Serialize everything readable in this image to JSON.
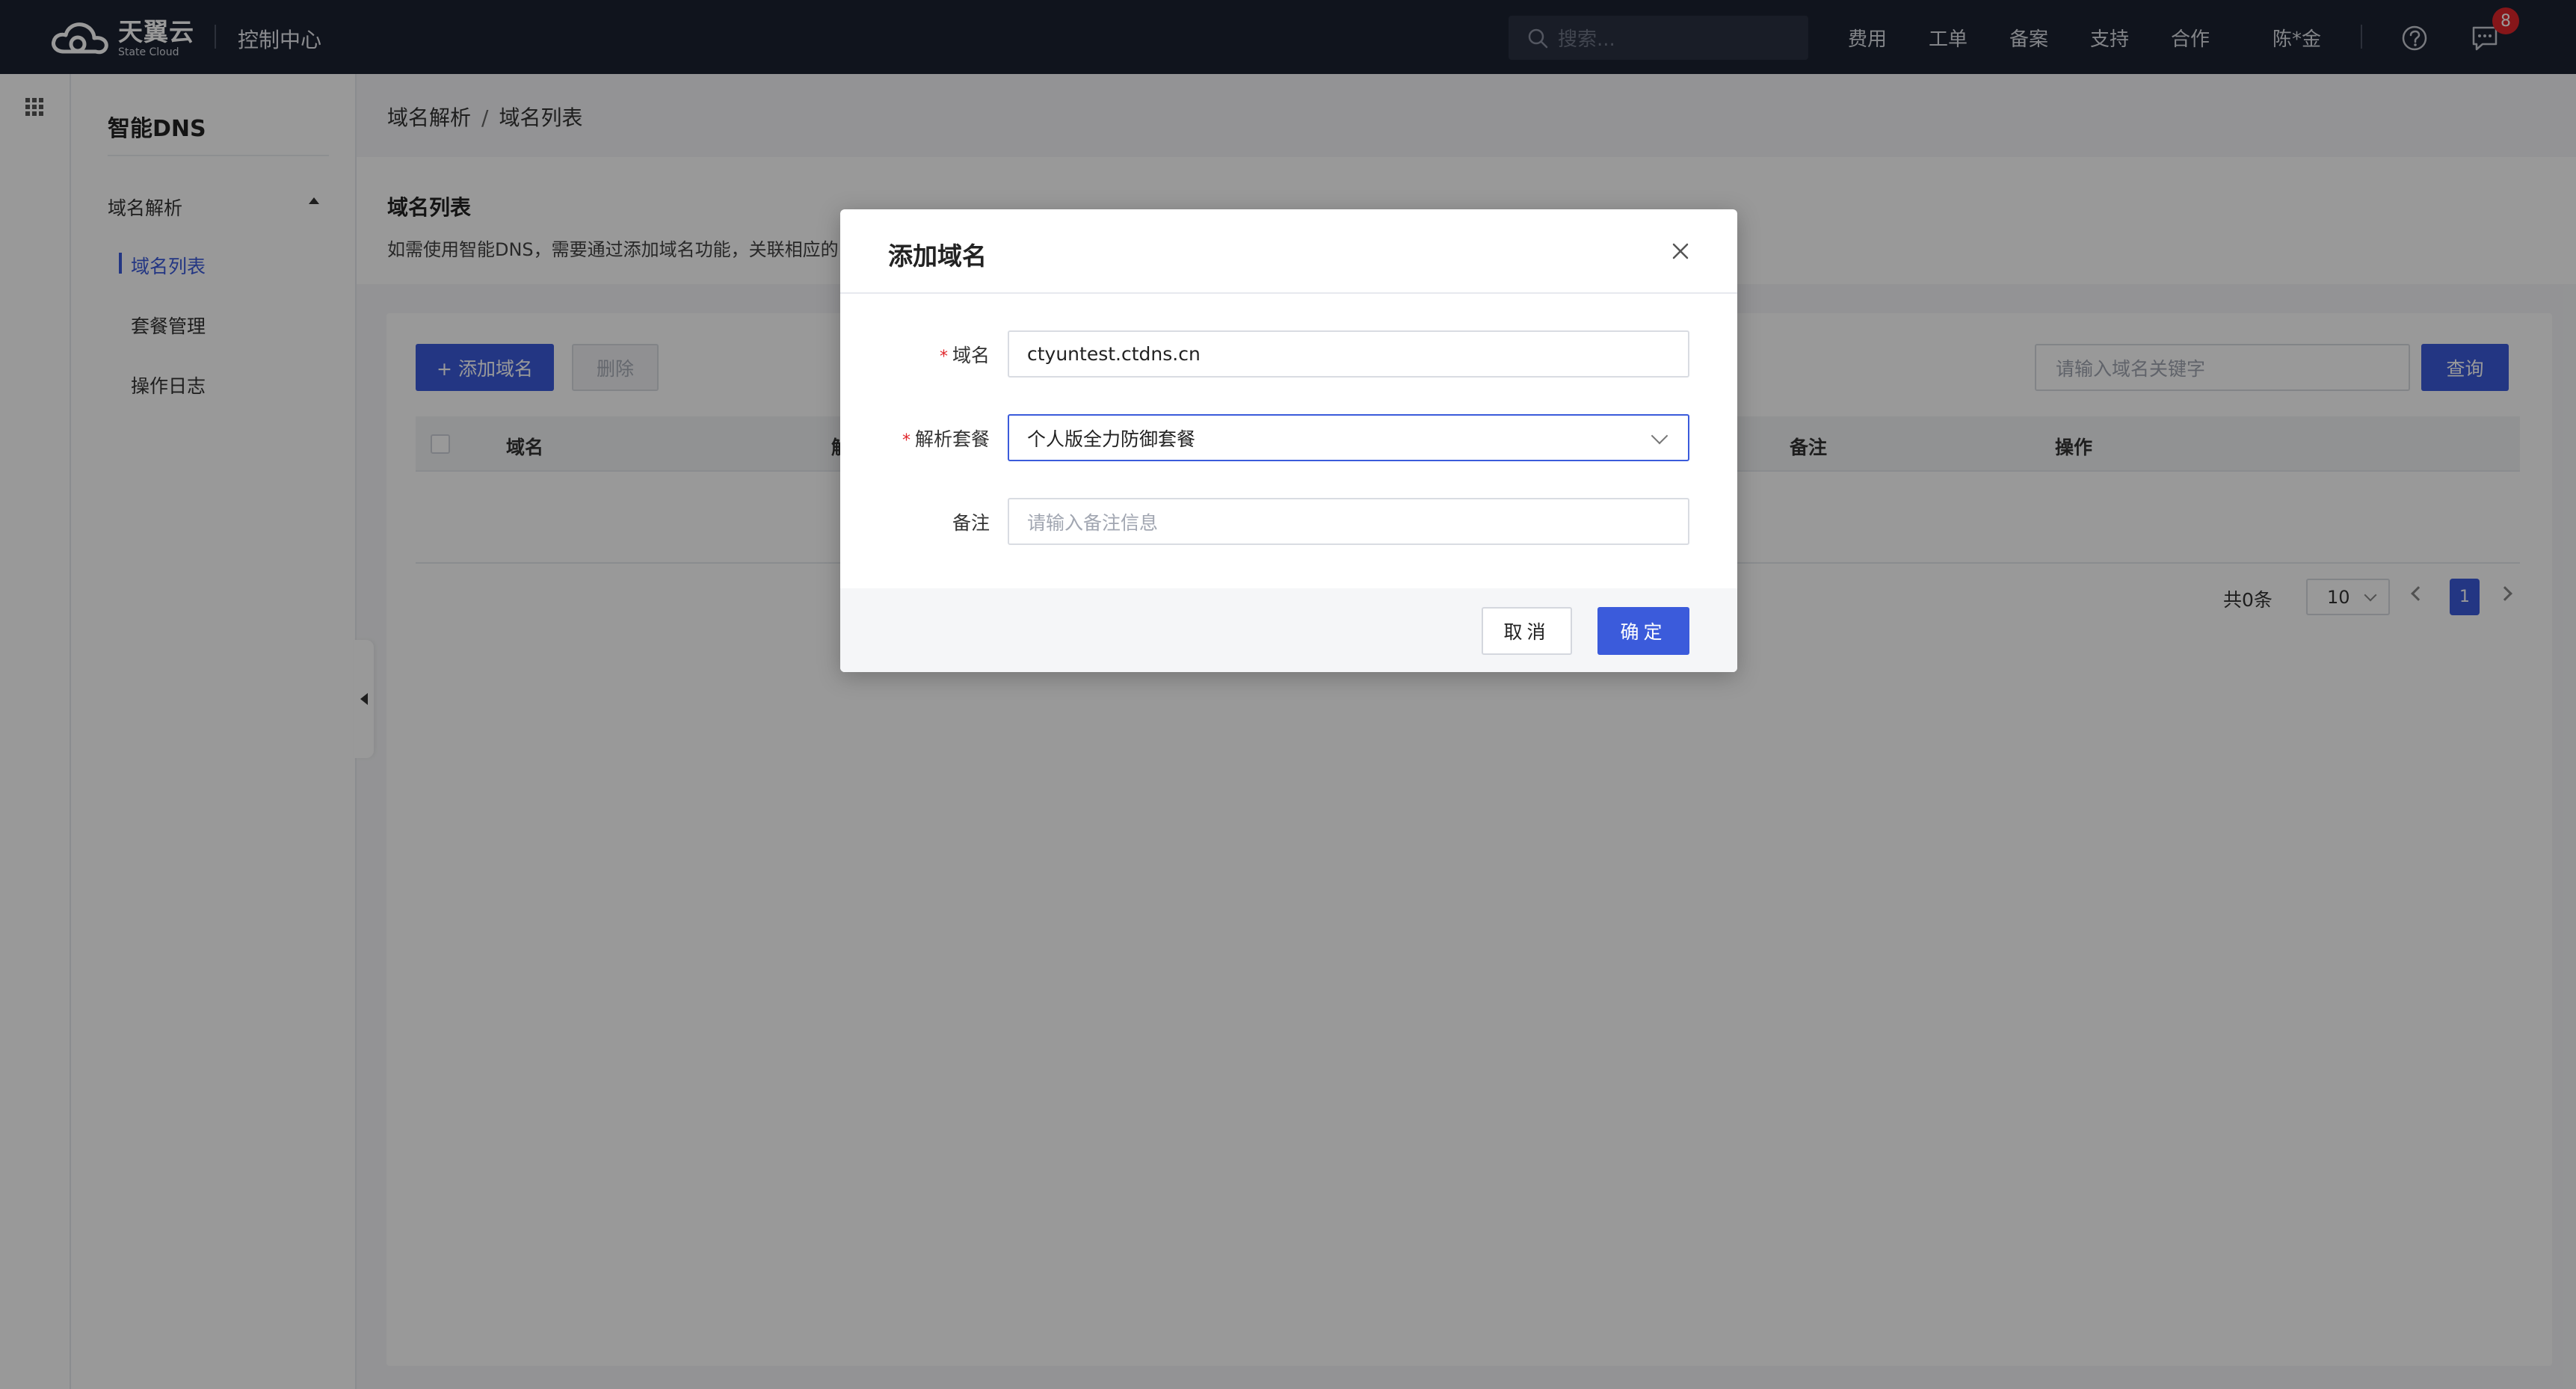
{
  "topbar": {
    "brand_cn": "天翼云",
    "brand_en": "State Cloud",
    "console": "控制中心",
    "search_placeholder": "搜索...",
    "nav": [
      "费用",
      "工单",
      "备案",
      "支持",
      "合作"
    ],
    "user": "陈*金",
    "message_count": "8"
  },
  "sidebar": {
    "title": "智能DNS",
    "group": "域名解析",
    "items": [
      "域名列表",
      "套餐管理",
      "操作日志"
    ],
    "active_index": 0
  },
  "breadcrumb": [
    "域名解析",
    "域名列表"
  ],
  "page": {
    "heading": "域名列表",
    "description": "如需使用智能DNS，需要通过添加域名功能，关联相应的"
  },
  "toolbar": {
    "add_label": "+ 添加域名",
    "delete_label": "删除",
    "keyword_placeholder": "请输入域名关键字",
    "query_label": "查询"
  },
  "table": {
    "columns": [
      "域名",
      "解",
      "备注",
      "操作"
    ]
  },
  "pagination": {
    "total": "共0条",
    "page_size": "10",
    "current_page": "1"
  },
  "modal": {
    "title": "添加域名",
    "fields": {
      "domain_label": "域名",
      "domain_value": "ctyuntest.ctdns.cn",
      "package_label": "解析套餐",
      "package_value": "个人版全力防御套餐",
      "remark_label": "备注",
      "remark_placeholder": "请输入备注信息"
    },
    "cancel_label": "取消",
    "ok_label": "确定"
  },
  "colors": {
    "topbar": "#1c2231",
    "primary": "#3b5bdb",
    "badge": "#e0262b"
  }
}
